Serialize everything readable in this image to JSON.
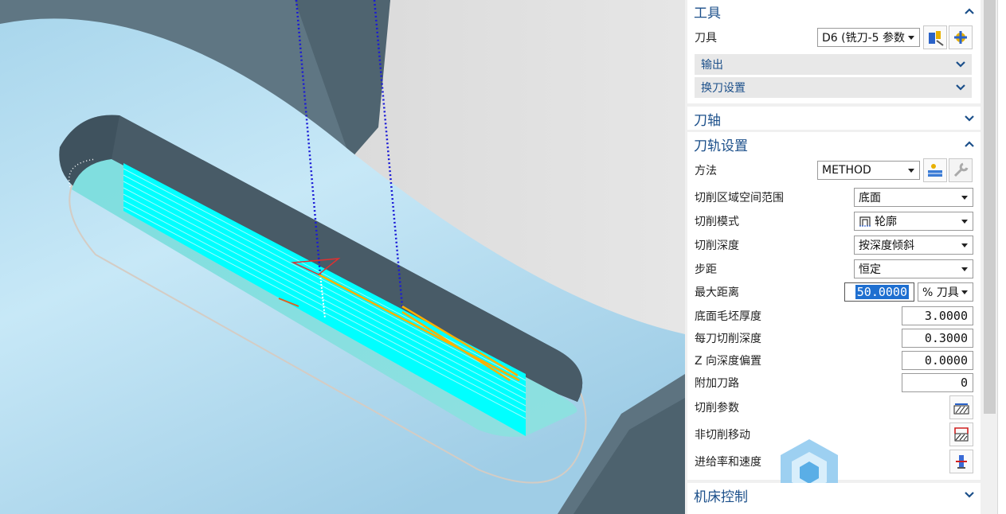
{
  "panel": {
    "tool_section": {
      "title": "工具",
      "tool_label": "刀具",
      "tool_value": "D6 (铣刀-5 参数",
      "output_label": "输出",
      "tool_change_label": "换刀设置"
    },
    "axis_section": {
      "title": "刀轴"
    },
    "path_section": {
      "title": "刀轨设置",
      "method_label": "方法",
      "method_value": "METHOD",
      "cut_region_label": "切削区域空间范围",
      "cut_region_value": "底面",
      "cut_pattern_label": "切削模式",
      "cut_pattern_value": "轮廓",
      "cut_depth_label": "切削深度",
      "cut_depth_value": "按深度倾斜",
      "stepover_label": "步距",
      "stepover_value": "恒定",
      "max_distance_label": "最大距离",
      "max_distance_value": "50.0000",
      "max_distance_unit": "% 刀具",
      "floor_stock_label": "底面毛坯厚度",
      "floor_stock_value": "3.0000",
      "depth_per_cut_label": "每刀切削深度",
      "depth_per_cut_value": "0.3000",
      "z_offset_label": "Z 向深度偏置",
      "z_offset_value": "0.0000",
      "extra_passes_label": "附加刀路",
      "extra_passes_value": "0",
      "cut_params_label": "切削参数",
      "non_cut_label": "非切削移动",
      "feeds_label": "进给率和速度"
    },
    "machine_section": {
      "title": "机床控制"
    }
  },
  "icons": {
    "edit_tool": "edit-tool-icon",
    "new_tool": "new-tool-icon",
    "edit_method": "edit-method-icon",
    "wrench": "wrench-icon",
    "contour_pattern": "contour-pattern-icon",
    "cut_params": "cut-params-icon",
    "non_cut": "non-cut-moves-icon",
    "feeds": "feeds-speeds-icon"
  },
  "colors": {
    "accent": "#1b4f8a",
    "part_surface": "#bfe3f3",
    "pocket_floor": "#00ffff",
    "toolpath": "#ffb000",
    "selection": "#1e6fd0"
  }
}
